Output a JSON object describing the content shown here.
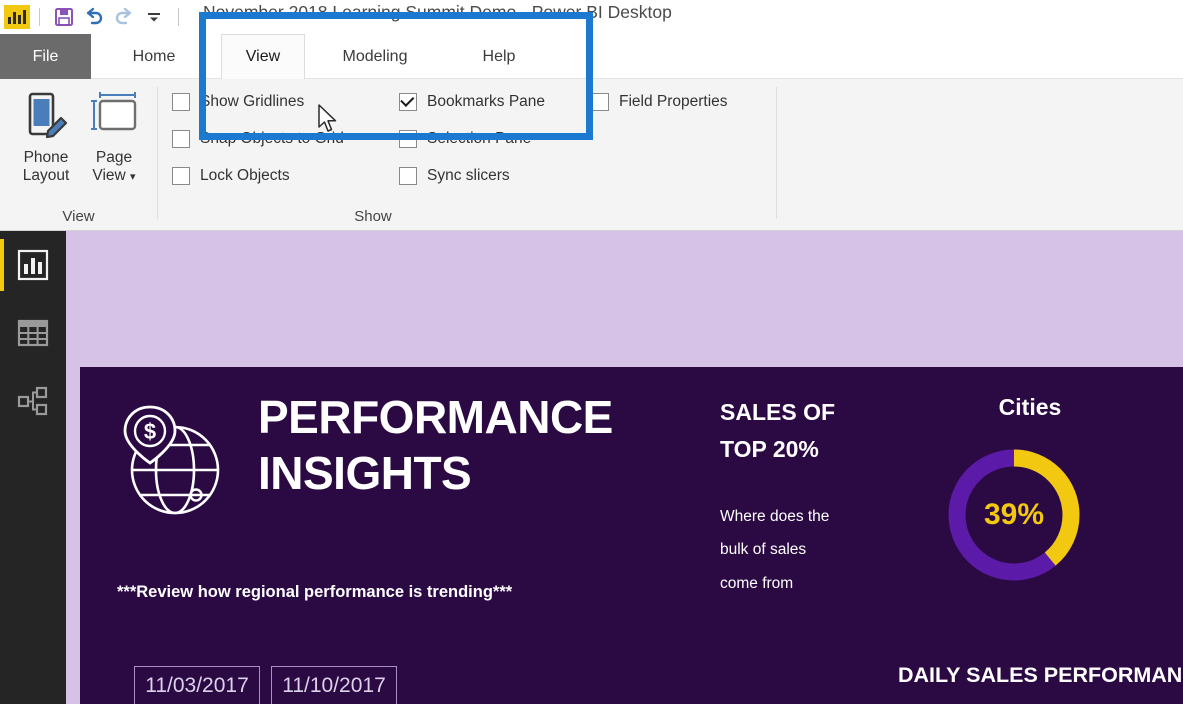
{
  "window": {
    "title": "November 2018 Learning Summit Demo - Power BI Desktop",
    "logo_icon": "power-bi-logo-icon",
    "quick_access": [
      {
        "name": "save-icon",
        "label": "Save"
      },
      {
        "name": "undo-icon",
        "label": "Undo"
      },
      {
        "name": "redo-icon",
        "label": "Redo"
      },
      {
        "name": "customize-quick-access-toolbar-icon",
        "label": "Customize Quick Access Toolbar"
      }
    ]
  },
  "ribbon": {
    "file_tab": "File",
    "tabs": [
      {
        "label": "Home",
        "active": false
      },
      {
        "label": "View",
        "active": true
      },
      {
        "label": "Modeling",
        "active": false
      },
      {
        "label": "Help",
        "active": false
      }
    ],
    "groups": [
      {
        "name": "view",
        "label": "View",
        "buttons": [
          {
            "label_line1": "Phone",
            "label_line2": "Layout",
            "icon": "phone-layout-icon",
            "has_dropdown": false
          },
          {
            "label_line1": "Page",
            "label_line2": "View",
            "icon": "page-view-icon",
            "has_dropdown": true
          }
        ]
      },
      {
        "name": "show",
        "label": "Show",
        "checkboxes": [
          {
            "label": "Show Gridlines",
            "checked": false
          },
          {
            "label": "Snap Objects to Grid",
            "checked": false
          },
          {
            "label": "Lock Objects",
            "checked": false
          },
          {
            "label": "Bookmarks Pane",
            "checked": true
          },
          {
            "label": "Selection Pane",
            "checked": false
          },
          {
            "label": "Sync slicers",
            "checked": false
          },
          {
            "label": "Field Properties",
            "checked": false
          }
        ]
      }
    ],
    "highlight_color": "#1b79d0"
  },
  "leftnav": {
    "items": [
      {
        "name": "report-view-icon",
        "label": "Report view",
        "active": true
      },
      {
        "name": "data-view-icon",
        "label": "Data view",
        "active": false
      },
      {
        "name": "model-view-icon",
        "label": "Model view",
        "active": false
      }
    ],
    "accent_color": "#f2c811"
  },
  "report": {
    "background_color": "#2b0a44",
    "canvas_color": "#d6c2e6",
    "header": {
      "icon": "globe-dollar-pin-icon",
      "title_line1": "PERFORMANCE",
      "title_line2": "INSIGHTS",
      "subtitle": "***Review how regional performance is trending***"
    },
    "kpi": {
      "title_line1": "SALES OF",
      "title_line2": "TOP 20%",
      "desc_line1": "Where does the",
      "desc_line2": "bulk of sales",
      "desc_line3": "come from"
    },
    "donut": {
      "label": "Cities",
      "value": "39%",
      "percent": 39,
      "fill_color": "#f2c811",
      "track_color": "#5b1ba8"
    },
    "date_buttons": [
      {
        "label": "11/03/2017"
      },
      {
        "label": "11/10/2017"
      }
    ],
    "daily_title": "DAILY SALES PERFORMAN"
  }
}
